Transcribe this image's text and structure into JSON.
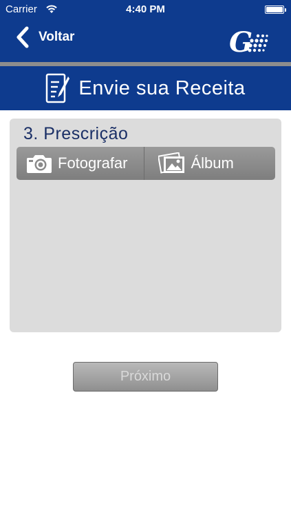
{
  "status_bar": {
    "carrier": "Carrier",
    "time": "4:40 PM"
  },
  "nav": {
    "back_label": "Voltar",
    "logo_icon": "brand-logo-g"
  },
  "header": {
    "title": "Envie sua Receita",
    "icon": "document-edit-icon"
  },
  "card": {
    "section_title": "3. Prescrição",
    "buttons": [
      {
        "label": "Fotografar",
        "icon": "camera-icon"
      },
      {
        "label": "Álbum",
        "icon": "photo-album-icon"
      }
    ]
  },
  "footer": {
    "next_label": "Próximo"
  },
  "colors": {
    "primary": "#0e3b8e",
    "card_bg": "#dcdcdc",
    "button_gray": "#8a8a8a"
  }
}
